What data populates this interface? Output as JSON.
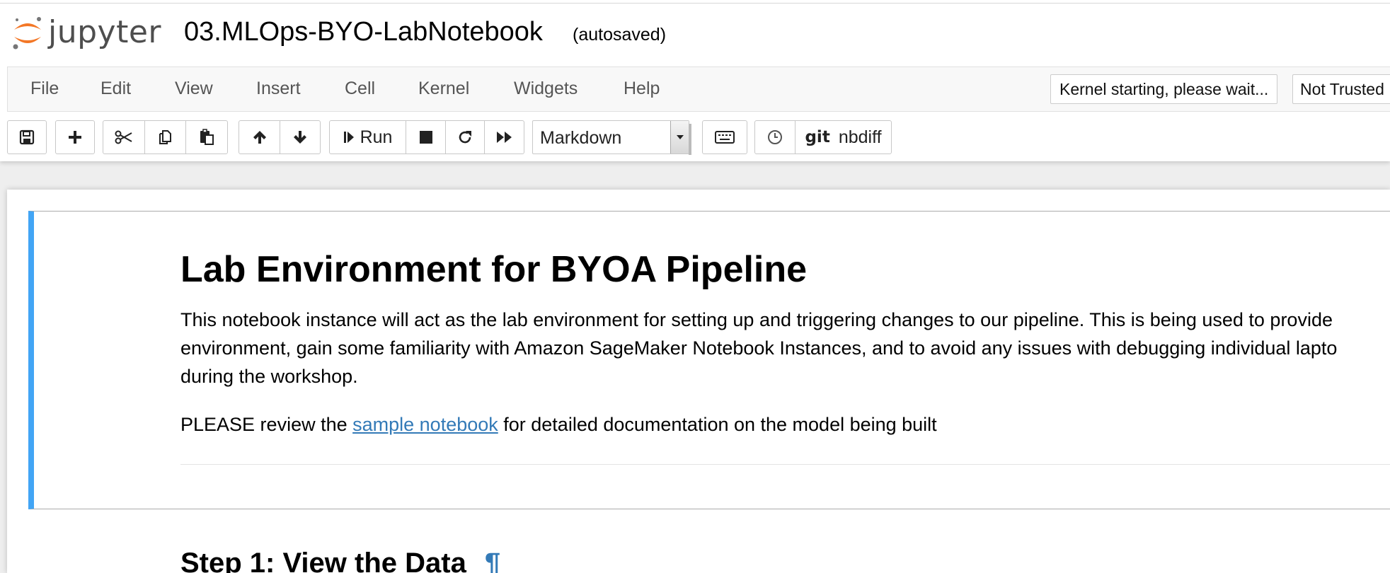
{
  "header": {
    "logo_text": "jupyter",
    "notebook_title": "03.MLOps-BYO-LabNotebook",
    "autosave_status": "(autosaved)"
  },
  "menubar": {
    "items": [
      "File",
      "Edit",
      "View",
      "Insert",
      "Cell",
      "Kernel",
      "Widgets",
      "Help"
    ],
    "kernel_status": "Kernel starting, please wait...",
    "trusted": "Not Trusted"
  },
  "toolbar": {
    "run_label": "Run",
    "cell_type": "Markdown",
    "git_label": "git",
    "nbdiff_label": "nbdiff",
    "icons": [
      "save-icon",
      "plus-icon",
      "scissors-icon",
      "copy-icon",
      "paste-icon",
      "arrow-up-icon",
      "arrow-down-icon",
      "step-forward-icon",
      "stop-icon",
      "redo-icon",
      "fast-forward-icon",
      "keyboard-icon",
      "history-icon"
    ]
  },
  "cell": {
    "heading": "Lab Environment for BYOA Pipeline",
    "paragraph_lines": [
      "This notebook instance will act as the lab environment for setting up and triggering changes to our pipeline. This is being used to provide",
      "environment, gain some familiarity with Amazon SageMaker Notebook Instances, and to avoid any issues with debugging individual lapto",
      "during the workshop."
    ],
    "review_prefix": "PLEASE review the ",
    "review_link": "sample notebook",
    "review_suffix": " for detailed documentation on the model being built"
  },
  "next_cell": {
    "heading": "Step 1: View the Data",
    "anchor": "¶"
  },
  "colors": {
    "selected_cell_border": "#42a5f5",
    "link": "#337ab7",
    "logo_orange": "#f37726"
  }
}
